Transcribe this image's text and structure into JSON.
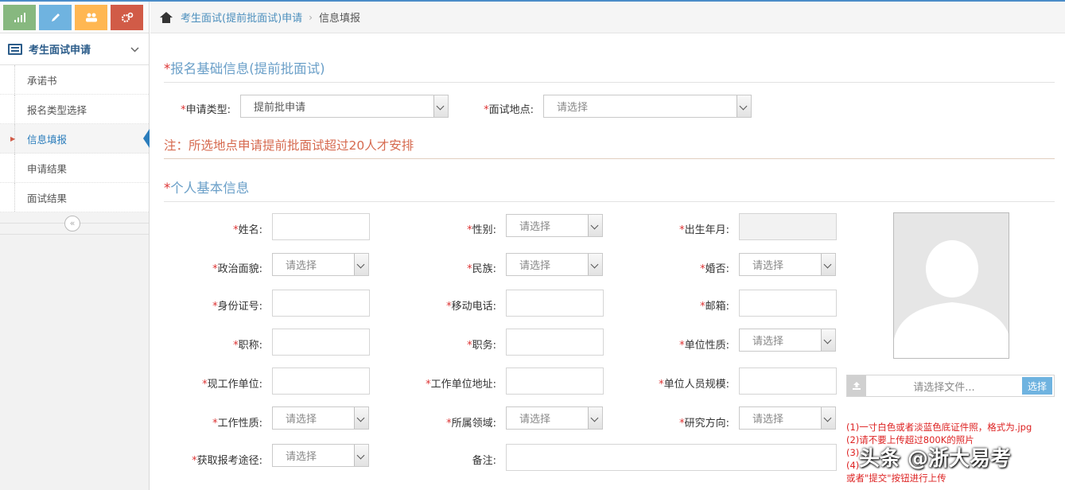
{
  "sidebar": {
    "section_label": "考生面试申请",
    "items": [
      {
        "label": "承诺书"
      },
      {
        "label": "报名类型选择"
      },
      {
        "label": "信息填报"
      },
      {
        "label": "申请结果"
      },
      {
        "label": "面试结果"
      }
    ]
  },
  "breadcrumb": {
    "link": "考生面试(提前批面试)申请",
    "current": "信息填报"
  },
  "section1": {
    "title": "报名基础信息(提前批面试)",
    "apply_type_label": "申请类型:",
    "apply_type_value": "提前批申请",
    "location_label": "面试地点:",
    "location_value": "请选择"
  },
  "note": "注：所选地点申请提前批面试超过20人才安排",
  "section2": {
    "title": "个人基本信息",
    "fields": {
      "name": {
        "label": "姓名:"
      },
      "gender": {
        "label": "性别:",
        "value": "请选择"
      },
      "birth": {
        "label": "出生年月:"
      },
      "political": {
        "label": "政治面貌:",
        "value": "请选择"
      },
      "ethnic": {
        "label": "民族:",
        "value": "请选择"
      },
      "marital": {
        "label": "婚否:",
        "value": "请选择"
      },
      "idcard": {
        "label": "身份证号:"
      },
      "mobile": {
        "label": "移动电话:"
      },
      "email": {
        "label": "邮箱:"
      },
      "title": {
        "label": "职称:"
      },
      "duty": {
        "label": "职务:"
      },
      "unit_nature": {
        "label": "单位性质:",
        "value": "请选择"
      },
      "workplace": {
        "label": "现工作单位:"
      },
      "work_address": {
        "label": "工作单位地址:"
      },
      "unit_size": {
        "label": "单位人员规模:"
      },
      "work_nature": {
        "label": "工作性质:",
        "value": "请选择"
      },
      "field": {
        "label": "所属领域:",
        "value": "请选择"
      },
      "research": {
        "label": "研究方向:",
        "value": "请选择"
      },
      "source": {
        "label": "获取报考途径:",
        "value": "请选择"
      },
      "remark": {
        "label": "备注:"
      }
    }
  },
  "photo": {
    "file_placeholder": "请选择文件...",
    "choose_label": "选择",
    "notes": [
      "(1)一寸白色或者淡蓝色底证件照，格式为.jpg",
      "(2)请不要上传超过800K的照片",
      "(3)",
      "(4)",
      "或者\"提交\"按钮进行上传"
    ]
  },
  "watermark": "头条 @浙大易考",
  "colors": {
    "accent": "#4c8fbd",
    "required": "#dd3333",
    "note": "#d66a4f"
  }
}
